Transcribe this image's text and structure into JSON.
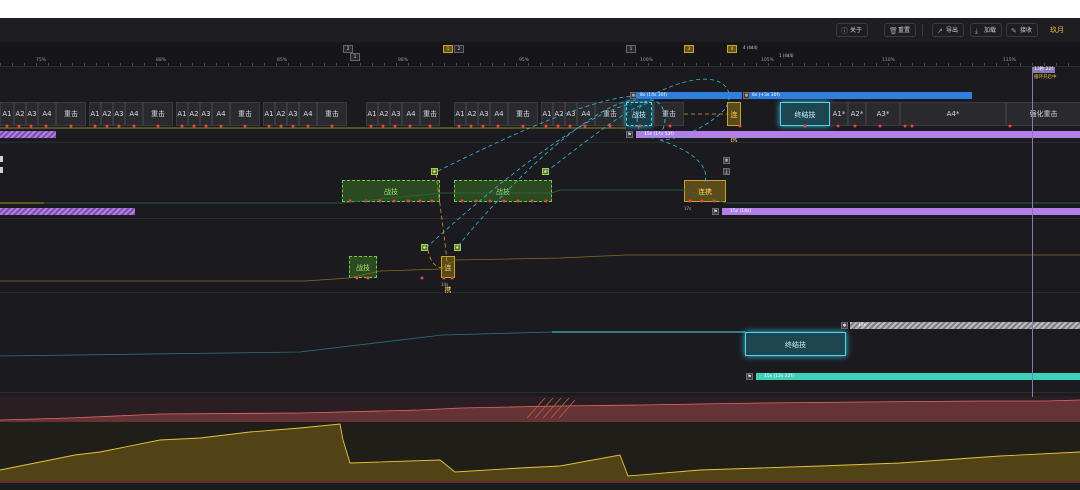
{
  "toolbar": {
    "about_label": "关于",
    "reset_label": "重置",
    "export_label": "导出",
    "load_label": "加载",
    "collect_label": "接收",
    "user_name": "玖月"
  },
  "ruler": {
    "labels": [
      "75%",
      "88%",
      "85%",
      "98%",
      "95%",
      "100%",
      "105%",
      "110%",
      "115%"
    ],
    "marks": [
      "2",
      "1",
      "2",
      "3",
      "1",
      "3",
      "4",
      "4 (4d4)",
      "1 (4d4)"
    ]
  },
  "cursor": {
    "tag": "13秒 22f",
    "sub": "循环开启中"
  },
  "lane1": {
    "attack_labels": [
      "A1",
      "A2",
      "A3",
      "A4",
      "重击",
      "A1",
      "A2",
      "A3",
      "A4",
      "重击",
      "A1",
      "A2",
      "A3",
      "A4",
      "重击",
      "A1",
      "A2",
      "A3",
      "A4",
      "重击",
      "A1",
      "A2",
      "A3",
      "A4",
      "重击",
      "A1",
      "A2",
      "A3",
      "A4",
      "重击",
      "A1",
      "A2",
      "A3",
      "A4",
      "重击"
    ],
    "skill_label": "战技",
    "heavy_label": "重击",
    "combo_label": "连携",
    "finisher_label": "终结技",
    "tail_labels": [
      "A1*",
      "A2*",
      "A3*",
      "A4*",
      "强化重击"
    ],
    "blue_bar_1": "8s (14s 30f)",
    "blue_bar_2": "6s (+3s 30f)",
    "purple_bar": "15s (14s 53f)"
  },
  "lane2": {
    "skill_label": "战技",
    "combo_label": "连携",
    "combo_time": "17s",
    "purple_bar": "15s (14s)"
  },
  "lane3": {
    "skill_label": "战技",
    "combo_label": "连携",
    "combo_time": "14s"
  },
  "lane4": {
    "finisher_label": "终结技",
    "grey_bar": "12s",
    "teal_bar": "15s (12s 22f)"
  },
  "icons": {
    "leaf": "leaf-icon",
    "fire": "fire-icon",
    "snow": "snowflake-icon",
    "flag": "flag-icon"
  },
  "colors": {
    "accent_yellow": "#e8c33a",
    "blue": "#2f7fe0",
    "purple": "#b27fe6",
    "teal": "#3ed0b8",
    "skill_green": "#6ec84a",
    "finisher_cyan": "#48d8f0",
    "combo_line": "#3ab4e0",
    "hp_red": "#c85a5a",
    "energy_yellow": "#c9a22a"
  }
}
